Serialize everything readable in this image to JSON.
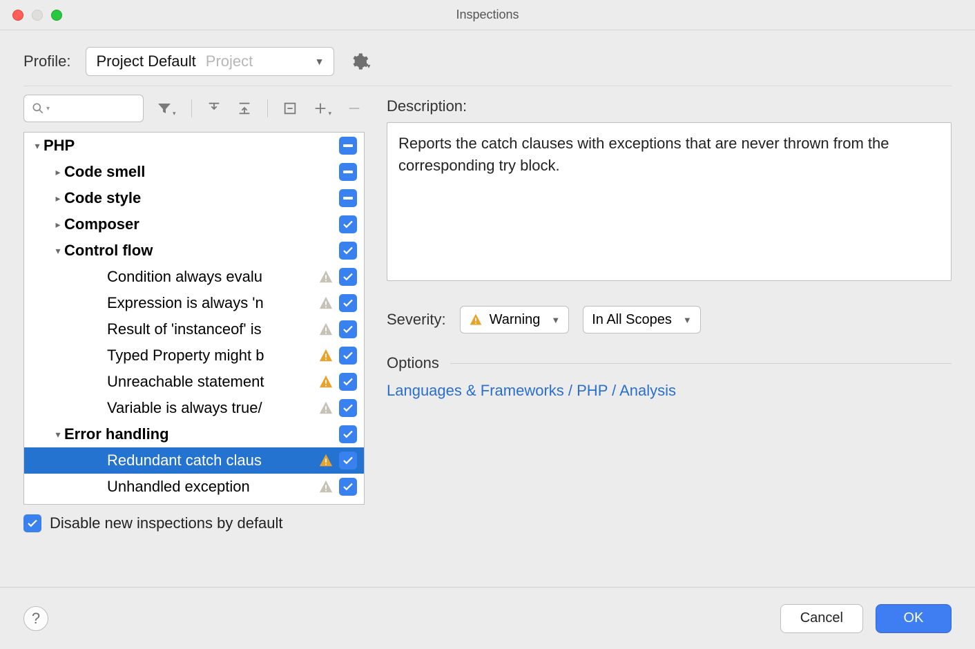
{
  "window": {
    "title": "Inspections"
  },
  "profile": {
    "label": "Profile:",
    "selected_name": "Project Default",
    "selected_scope": "Project"
  },
  "search": {
    "placeholder": ""
  },
  "tree": [
    {
      "label": "PHP",
      "level": 0,
      "bold": true,
      "arrow": "down",
      "check": "indet"
    },
    {
      "label": "Code smell",
      "level": 1,
      "bold": true,
      "arrow": "right",
      "check": "indet"
    },
    {
      "label": "Code style",
      "level": 1,
      "bold": true,
      "arrow": "right",
      "check": "indet"
    },
    {
      "label": "Composer",
      "level": 1,
      "bold": true,
      "arrow": "right",
      "check": "on"
    },
    {
      "label": "Control flow",
      "level": 1,
      "bold": true,
      "arrow": "down",
      "check": "on"
    },
    {
      "label": "Condition always evalu",
      "level": 2,
      "warn": "gray",
      "check": "on"
    },
    {
      "label": "Expression is always 'n",
      "level": 2,
      "warn": "gray",
      "check": "on"
    },
    {
      "label": "Result of 'instanceof' is",
      "level": 2,
      "warn": "gray",
      "check": "on"
    },
    {
      "label": "Typed Property might b",
      "level": 2,
      "warn": "yellow",
      "check": "on"
    },
    {
      "label": "Unreachable statement",
      "level": 2,
      "warn": "yellow",
      "check": "on"
    },
    {
      "label": "Variable is always true/",
      "level": 2,
      "warn": "gray",
      "check": "on"
    },
    {
      "label": "Error handling",
      "level": 1,
      "bold": true,
      "arrow": "down",
      "check": "on"
    },
    {
      "label": "Redundant catch claus",
      "level": 2,
      "warn": "yellow",
      "check": "on",
      "selected": true
    },
    {
      "label": "Unhandled exception",
      "level": 2,
      "warn": "gray",
      "check": "on"
    }
  ],
  "disable_new_label": "Disable new inspections by default",
  "disable_new_checked": true,
  "description": {
    "label": "Description:",
    "text": "Reports the catch clauses with exceptions that are never thrown from the corresponding try block."
  },
  "severity": {
    "label": "Severity:",
    "level": "Warning",
    "scope": "In All Scopes"
  },
  "options": {
    "label": "Options",
    "link": "Languages & Frameworks / PHP / Analysis"
  },
  "footer": {
    "cancel": "Cancel",
    "ok": "OK"
  }
}
